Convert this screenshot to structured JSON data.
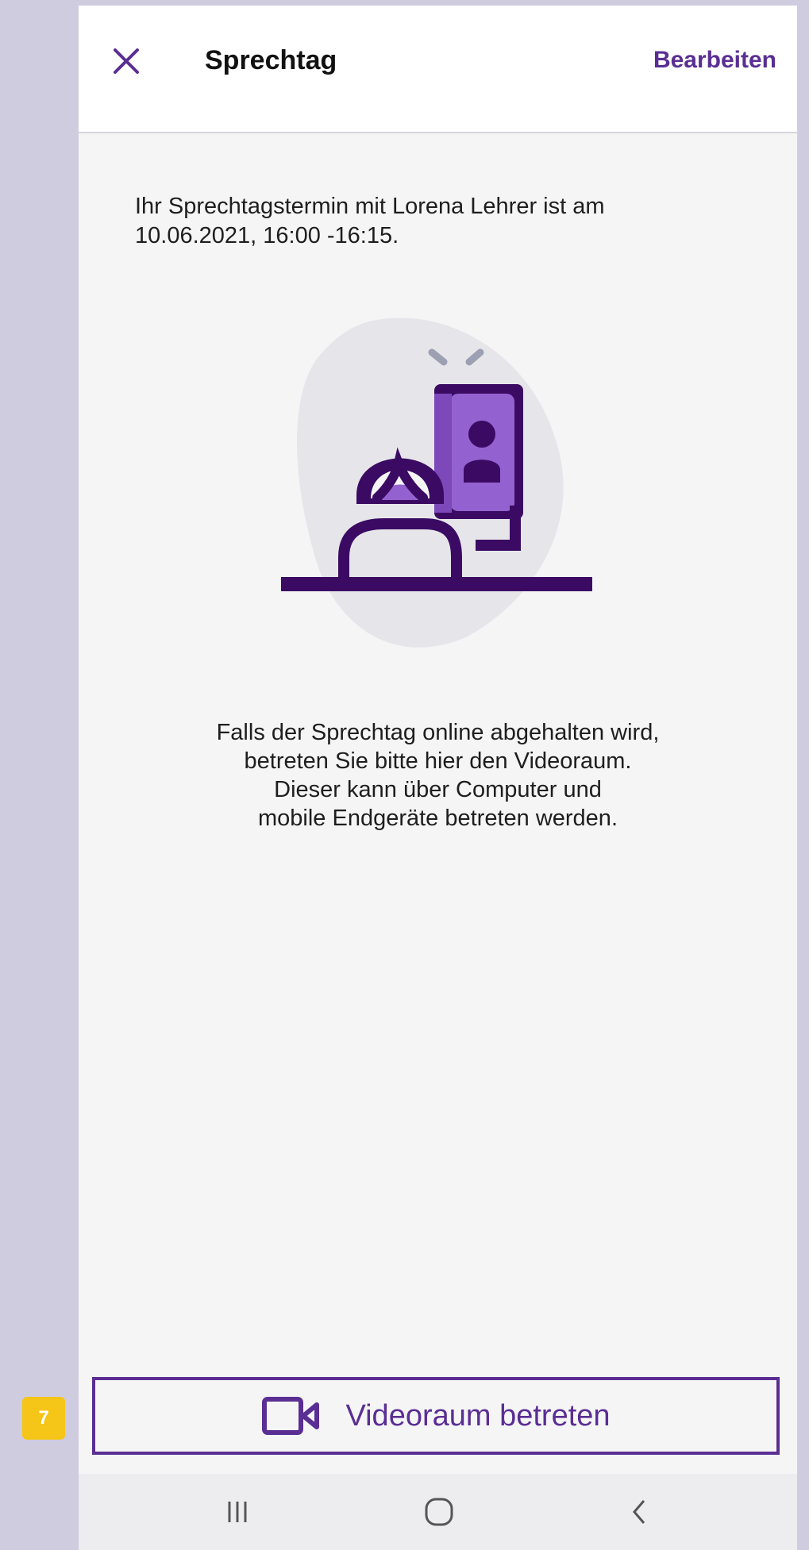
{
  "header": {
    "title": "Sprechtag",
    "edit_label": "Bearbeiten",
    "close_icon": "close-icon"
  },
  "main": {
    "intro_text": "Ihr Sprechtagstermin mit Lorena Lehrer ist am 10.06.2021, 16:00 -16:15.",
    "info_lines": [
      "Falls der Sprechtag online abgehalten wird,",
      "betreten Sie bitte hier den Videoraum.",
      "Dieser kann über Computer und",
      "mobile Endgeräte betreten werden."
    ]
  },
  "video_button": {
    "label": "Videoraum betreten",
    "icon": "video-camera-icon"
  },
  "step_badge": "7",
  "navbar": {
    "items": [
      "recent-apps-icon",
      "home-icon",
      "back-icon"
    ]
  },
  "colors": {
    "accent": "#5a2e93",
    "illustration_dark": "#3b0b63",
    "illustration_purple": "#9462d0",
    "badge": "#f5c518"
  }
}
